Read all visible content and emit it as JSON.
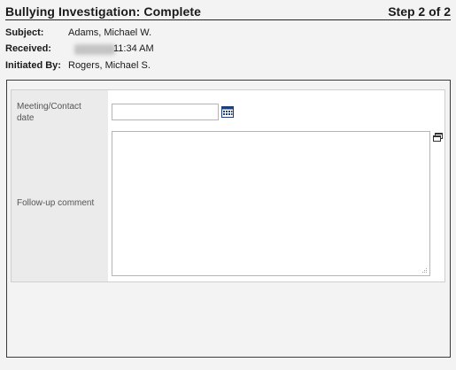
{
  "header": {
    "title": "Bullying Investigation: Complete",
    "step": "Step 2 of 2"
  },
  "meta": {
    "subject_label": "Subject:",
    "subject_value": "Adams, Michael W.",
    "received_label": "Received:",
    "received_time": "11:34 AM",
    "initiated_label": "Initiated By:",
    "initiated_value": "Rogers, Michael S."
  },
  "form": {
    "meeting_date_label": "Meeting/Contact date",
    "meeting_date_value": "",
    "followup_label": "Follow-up comment",
    "followup_value": ""
  },
  "icons": {
    "calendar": "calendar-icon",
    "expand": "expand-window-icon",
    "resize": "resize-grip-icon"
  },
  "colors": {
    "calendar_icon": "#1f3f78",
    "label_column_bg": "#ebebeb",
    "page_bg": "#f3f3f3"
  }
}
